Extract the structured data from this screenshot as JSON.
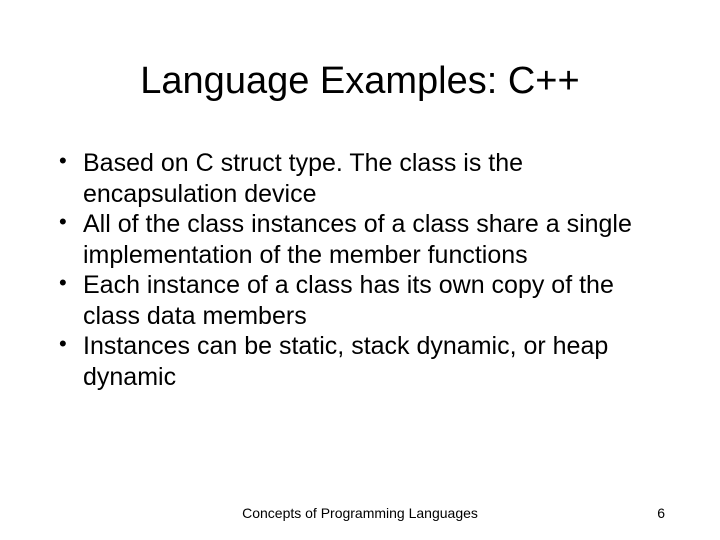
{
  "slide": {
    "title": "Language Examples: C++",
    "bullets": [
      "Based on C struct type. The class is the encapsulation device",
      "All of the class instances of a class share a single implementation of the member functions",
      "Each instance of a class has its own copy of the class data members",
      "Instances can be static, stack dynamic, or heap dynamic"
    ],
    "footer_center": "Concepts of Programming Languages",
    "page_number": "6"
  }
}
